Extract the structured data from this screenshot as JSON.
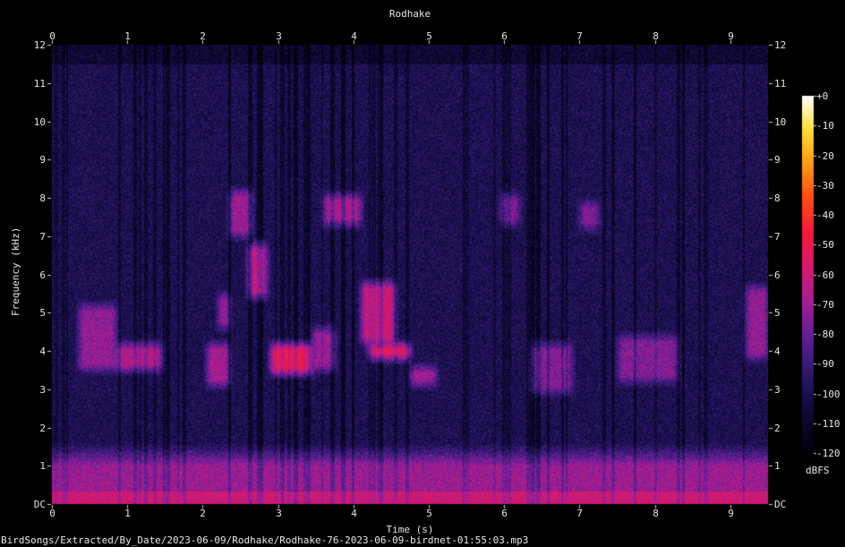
{
  "chart_data": {
    "type": "heatmap",
    "title": "Rodhake",
    "xlabel": "Time (s)",
    "ylabel": "Frequency (kHz)",
    "xlim": [
      0,
      9.5
    ],
    "ylim": [
      0,
      12
    ],
    "x_ticks": [
      "0",
      "1",
      "2",
      "3",
      "4",
      "5",
      "6",
      "7",
      "8",
      "9"
    ],
    "y_ticks": [
      "DC",
      "1",
      "2",
      "3",
      "4",
      "5",
      "6",
      "7",
      "8",
      "9",
      "10",
      "11",
      "12"
    ],
    "colorbar": {
      "label": "dBFS",
      "range": [
        -120,
        0
      ],
      "ticks": [
        "+0",
        "-10",
        "-20",
        "-30",
        "-40",
        "-50",
        "-60",
        "-70",
        "-80",
        "-90",
        "-100",
        "-110",
        "-120"
      ]
    },
    "background_level_db": -100,
    "low_frequency_band": {
      "freq_khz": [
        0,
        1
      ],
      "level_db": -65
    },
    "calls": [
      {
        "t": [
          0.35,
          0.85
        ],
        "f": [
          3.5,
          5.2
        ],
        "level_db": -72
      },
      {
        "t": [
          0.85,
          1.45
        ],
        "f": [
          3.5,
          4.2
        ],
        "level_db": -65
      },
      {
        "t": [
          2.05,
          2.35
        ],
        "f": [
          3.1,
          4.2
        ],
        "level_db": -68
      },
      {
        "t": [
          2.2,
          2.35
        ],
        "f": [
          4.6,
          5.5
        ],
        "level_db": -70
      },
      {
        "t": [
          2.35,
          2.65
        ],
        "f": [
          7.0,
          8.2
        ],
        "level_db": -70
      },
      {
        "t": [
          2.6,
          2.85
        ],
        "f": [
          5.4,
          6.8
        ],
        "level_db": -62
      },
      {
        "t": [
          2.9,
          3.45
        ],
        "f": [
          3.4,
          4.2
        ],
        "level_db": -50
      },
      {
        "t": [
          3.45,
          3.75
        ],
        "f": [
          3.5,
          4.6
        ],
        "level_db": -70
      },
      {
        "t": [
          3.6,
          4.1
        ],
        "f": [
          7.3,
          8.1
        ],
        "level_db": -68
      },
      {
        "t": [
          4.1,
          4.55
        ],
        "f": [
          4.2,
          5.8
        ],
        "level_db": -60
      },
      {
        "t": [
          4.2,
          4.75
        ],
        "f": [
          3.8,
          4.2
        ],
        "level_db": -52
      },
      {
        "t": [
          4.75,
          5.1
        ],
        "f": [
          3.1,
          3.6
        ],
        "level_db": -70
      },
      {
        "t": [
          5.95,
          6.2
        ],
        "f": [
          7.3,
          8.1
        ],
        "level_db": -75
      },
      {
        "t": [
          6.35,
          6.9
        ],
        "f": [
          2.9,
          4.2
        ],
        "level_db": -75
      },
      {
        "t": [
          7.0,
          7.25
        ],
        "f": [
          7.2,
          7.9
        ],
        "level_db": -75
      },
      {
        "t": [
          7.5,
          8.3
        ],
        "f": [
          3.2,
          4.4
        ],
        "level_db": -75
      },
      {
        "t": [
          9.2,
          9.5
        ],
        "f": [
          3.8,
          5.7
        ],
        "level_db": -72
      }
    ]
  },
  "footer_path": "BirdSongs/Extracted/By_Date/2023-06-09/Rodhake/Rodhake-76-2023-06-09-birdnet-01:55:03.mp3"
}
